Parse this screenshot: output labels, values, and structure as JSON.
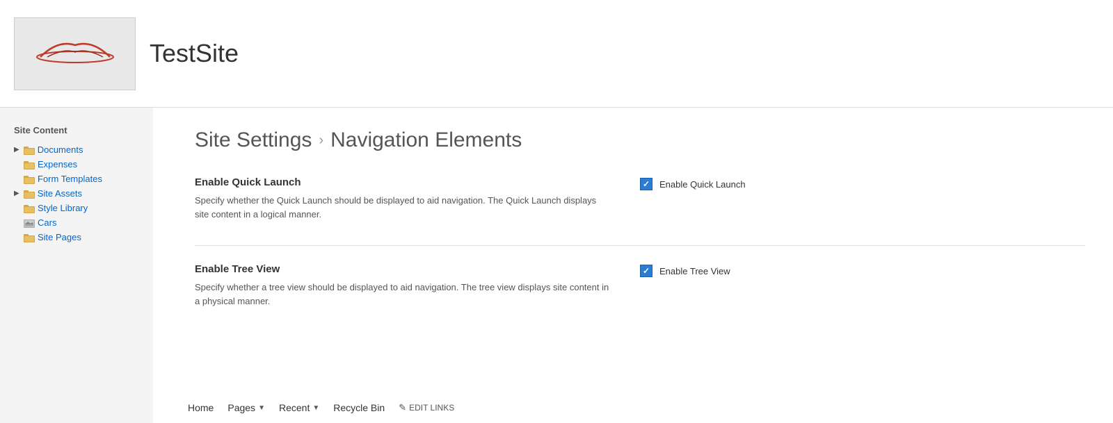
{
  "header": {
    "site_title": "TestSite",
    "nav": [
      {
        "label": "Home",
        "has_dropdown": false,
        "id": "home"
      },
      {
        "label": "Pages",
        "has_dropdown": true,
        "id": "pages"
      },
      {
        "label": "Recent",
        "has_dropdown": true,
        "id": "recent"
      },
      {
        "label": "Recycle Bin",
        "has_dropdown": false,
        "id": "recycle-bin"
      }
    ],
    "edit_links_label": "EDIT LINKS"
  },
  "sidebar": {
    "title": "Site Content",
    "items": [
      {
        "label": "Documents",
        "indent": 0,
        "expandable": true,
        "id": "documents"
      },
      {
        "label": "Expenses",
        "indent": 1,
        "expandable": false,
        "id": "expenses"
      },
      {
        "label": "Form Templates",
        "indent": 1,
        "expandable": false,
        "id": "form-templates"
      },
      {
        "label": "Site Assets",
        "indent": 0,
        "expandable": true,
        "id": "site-assets"
      },
      {
        "label": "Style Library",
        "indent": 1,
        "expandable": false,
        "id": "style-library"
      },
      {
        "label": "Cars",
        "indent": 1,
        "expandable": false,
        "id": "cars",
        "image_icon": true
      },
      {
        "label": "Site Pages",
        "indent": 1,
        "expandable": false,
        "id": "site-pages"
      }
    ]
  },
  "content": {
    "page_title_part1": "Site Settings",
    "page_title_separator": "›",
    "page_title_part2": "Navigation Elements",
    "sections": [
      {
        "id": "quick-launch",
        "heading": "Enable Quick Launch",
        "body": "Specify whether the Quick Launch should be displayed to aid navigation.  The Quick Launch displays site content in a logical manner.",
        "checkbox_checked": true,
        "checkbox_label": "Enable Quick Launch"
      },
      {
        "id": "tree-view",
        "heading": "Enable Tree View",
        "body": "Specify whether a tree view should be displayed to aid navigation.  The tree view displays site content in a physical manner.",
        "checkbox_checked": true,
        "checkbox_label": "Enable Tree View"
      }
    ]
  }
}
